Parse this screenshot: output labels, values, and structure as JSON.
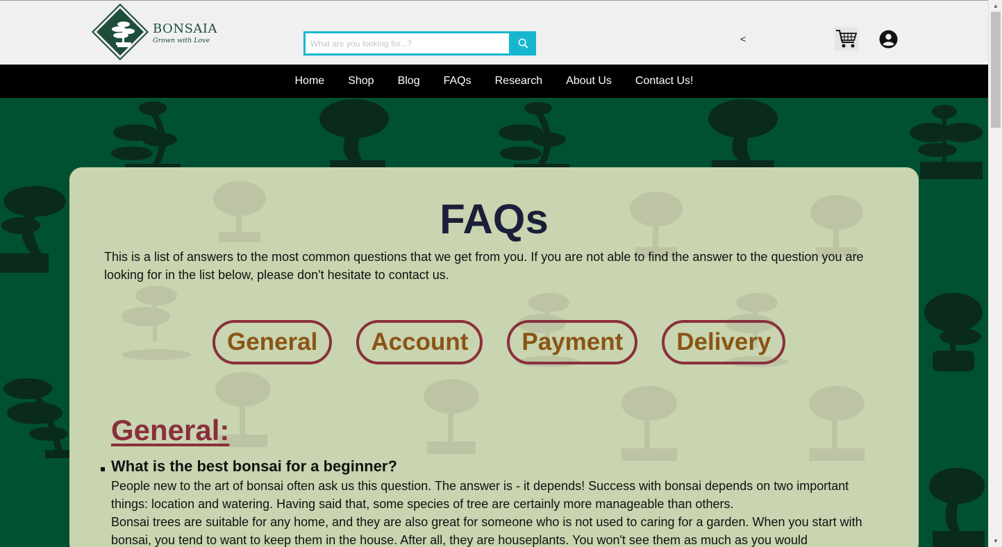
{
  "brand": {
    "name": "BONSAIA",
    "tagline": "Grown with Love"
  },
  "search": {
    "placeholder": "What are you looking for...?",
    "value": ""
  },
  "header": {
    "back_glyph": "<"
  },
  "icons": {
    "search": "search-icon",
    "cart": "cart-icon",
    "account": "account-icon"
  },
  "nav": {
    "items": [
      "Home",
      "Shop",
      "Blog",
      "FAQs",
      "Research",
      "About Us",
      "Contact Us!"
    ]
  },
  "colors": {
    "nav_bg": "#000000",
    "page_bg": "#005131",
    "card_bg": "#c8d5b0",
    "accent_teal": "#17b6cf",
    "title": "#1c1f3a",
    "section_heading": "#8b2f3c",
    "category_text": "#8b5414"
  },
  "main": {
    "title": "FAQs",
    "intro": "This is a list of answers to the most common questions that we get from you. If you are not able to find the answer to the question you are looking for in the list below, please don't hesitate to contact us.",
    "categories": [
      "General",
      "Account",
      "Payment",
      "Delivery"
    ],
    "section_heading": "General:",
    "faq": {
      "question": "What is the best bonsai for a beginner?",
      "answer_1": "People new to the art of bonsai often ask us this question. The answer is - it depends! Success with bonsai depends on two important things: location and watering. Having said that, some species of tree are certainly more manageable than others.",
      "answer_2": "Bonsai trees are suitable for any home, and they are also great for someone who is not used to caring for a garden. When you start with bonsai, you tend to want to keep them in the house. After all, they are houseplants. You won't see them as much as you would"
    }
  }
}
